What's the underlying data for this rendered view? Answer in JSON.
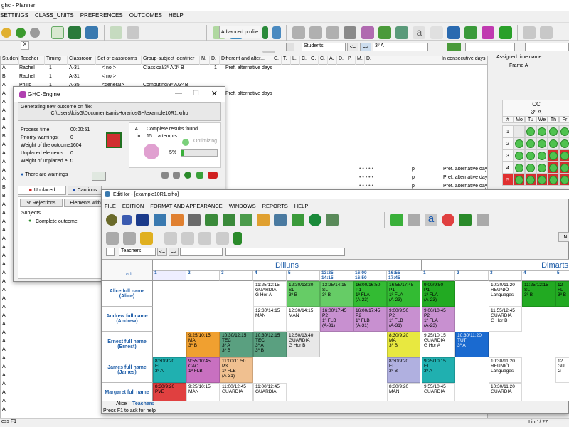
{
  "main": {
    "title": "ghc - Planner",
    "menu": [
      "SETTINGS",
      "CLASS_UNITS",
      "PREFERENCES",
      "OUTCOMES",
      "HELP"
    ],
    "toolbar": {
      "advanced_profile": "Advanced profile"
    },
    "filter": {
      "view": "Students",
      "nav_prev": "<=",
      "nav_next": "=>",
      "group": "3º A",
      "close": "X"
    },
    "columns": [
      "Students",
      "Teacher",
      "Timing",
      "Classroom",
      "Set of classrooms",
      "Group-subject identifier",
      "N.",
      "D.",
      "Different and alter...",
      "C.",
      "T.",
      "L.",
      "C.",
      "O.",
      "C.",
      "A.",
      "D.",
      "P.",
      "M.",
      "D.",
      "In consecutive days"
    ],
    "rows": [
      {
        "s": "A",
        "t": "Rachel",
        "tm": "1",
        "c": "A-31",
        "set": "< no >",
        "g": "Classical/3º A/3º B",
        "n": "1",
        "d": "Pref. alternative days"
      },
      {
        "s": "B",
        "t": "Rachel",
        "tm": "1",
        "c": "A-31",
        "set": "< no >",
        "g": "",
        "n": "",
        "d": ""
      },
      {
        "s": "A",
        "t": "Philip",
        "tm": "1",
        "c": "A-35",
        "set": "<general>",
        "g": "Computing/3º A/3º B",
        "n": "",
        "d": ""
      },
      {
        "s": "A",
        "t": "",
        "tm": "",
        "c": "",
        "set": "",
        "g": "",
        "n": "",
        "d": "Pref. alternative days"
      },
      {
        "s": "A",
        "t": "",
        "tm": "",
        "c": "",
        "set": "",
        "g": "",
        "n": "",
        "d": ""
      },
      {
        "s": "A",
        "t": "",
        "tm": "",
        "c": "",
        "set": "",
        "g": "",
        "n": "",
        "d": ""
      },
      {
        "s": "A",
        "t": "",
        "tm": "",
        "c": "",
        "set": "",
        "g": "",
        "n": "",
        "d": ""
      },
      {
        "s": "A",
        "t": "",
        "tm": "",
        "c": "",
        "set": "",
        "g": "",
        "n": "",
        "d": ""
      },
      {
        "s": "B",
        "t": "",
        "tm": "",
        "c": "",
        "set": "",
        "g": "",
        "n": "",
        "d": ""
      },
      {
        "s": "A",
        "t": "",
        "tm": "",
        "c": "",
        "set": "",
        "g": "",
        "n": "",
        "d": ""
      },
      {
        "s": "A",
        "t": "",
        "tm": "",
        "c": "",
        "set": "",
        "g": "",
        "n": "",
        "d": ""
      },
      {
        "s": "A",
        "t": "",
        "tm": "",
        "c": "",
        "set": "",
        "g": "",
        "n": "",
        "d": ""
      },
      {
        "s": "A",
        "t": "",
        "tm": "",
        "c": "",
        "set": "",
        "g": "",
        "n": "",
        "d": ""
      },
      {
        "s": "A",
        "t": "",
        "tm": "",
        "c": "",
        "set": "",
        "g": "",
        "n": "",
        "d": ""
      },
      {
        "s": "B",
        "t": "",
        "tm": "",
        "c": "",
        "set": "",
        "g": "",
        "n": "",
        "d": ""
      },
      {
        "s": "B",
        "t": "",
        "tm": "",
        "c": "",
        "set": "",
        "g": "",
        "n": "",
        "d": ""
      },
      {
        "s": "A",
        "t": "",
        "tm": "",
        "c": "",
        "set": "",
        "g": "",
        "n": "",
        "d": ""
      },
      {
        "s": "A",
        "t": "",
        "tm": "",
        "c": "",
        "set": "",
        "g": "",
        "n": "",
        "d": ""
      },
      {
        "s": "A",
        "t": "",
        "tm": "",
        "c": "",
        "set": "",
        "g": "",
        "n": "",
        "d": ""
      },
      {
        "s": "A",
        "t": "",
        "tm": "",
        "c": "",
        "set": "",
        "g": "",
        "n": "",
        "d": ""
      },
      {
        "s": "A",
        "t": "",
        "tm": "",
        "c": "",
        "set": "",
        "g": "",
        "n": "",
        "d": ""
      },
      {
        "s": "A",
        "t": "",
        "tm": "",
        "c": "",
        "set": "",
        "g": "",
        "n": "",
        "d": ""
      },
      {
        "s": "A",
        "t": "",
        "tm": "",
        "c": "",
        "set": "",
        "g": "",
        "n": "",
        "d": ""
      },
      {
        "s": "A",
        "t": "",
        "tm": "",
        "c": "",
        "set": "",
        "g": "",
        "n": "",
        "d": ""
      },
      {
        "s": "A",
        "t": "",
        "tm": "",
        "c": "",
        "set": "",
        "g": "",
        "n": "",
        "d": ""
      },
      {
        "s": "A",
        "t": "",
        "tm": "",
        "c": "",
        "set": "",
        "g": "",
        "n": "",
        "d": ""
      },
      {
        "s": "A",
        "t": "",
        "tm": "",
        "c": "",
        "set": "",
        "g": "",
        "n": "",
        "d": ""
      },
      {
        "s": "A",
        "t": "",
        "tm": "",
        "c": "",
        "set": "",
        "g": "",
        "n": "",
        "d": ""
      },
      {
        "s": "A",
        "t": "",
        "tm": "",
        "c": "",
        "set": "",
        "g": "",
        "n": "",
        "d": ""
      },
      {
        "s": "A",
        "t": "",
        "tm": "",
        "c": "",
        "set": "",
        "g": "",
        "n": "",
        "d": ""
      },
      {
        "s": "A",
        "t": "",
        "tm": "",
        "c": "",
        "set": "",
        "g": "",
        "n": "",
        "d": ""
      },
      {
        "s": "A",
        "t": "",
        "tm": "",
        "c": "",
        "set": "",
        "g": "",
        "n": "",
        "d": ""
      },
      {
        "s": "A",
        "t": "",
        "tm": "",
        "c": "",
        "set": "",
        "g": "",
        "n": "",
        "d": ""
      },
      {
        "s": "A",
        "t": "",
        "tm": "",
        "c": "",
        "set": "",
        "g": "",
        "n": "",
        "d": ""
      },
      {
        "s": "A",
        "t": "",
        "tm": "",
        "c": "",
        "set": "",
        "g": "",
        "n": "",
        "d": ""
      },
      {
        "s": "A",
        "t": "",
        "tm": "",
        "c": "",
        "set": "",
        "g": "",
        "n": "",
        "d": ""
      },
      {
        "s": "A",
        "t": "",
        "tm": "",
        "c": "",
        "set": "",
        "g": "",
        "n": "",
        "d": ""
      },
      {
        "s": "A",
        "t": "",
        "tm": "",
        "c": "",
        "set": "",
        "g": "",
        "n": "",
        "d": ""
      },
      {
        "s": "A",
        "t": "",
        "tm": "",
        "c": "",
        "set": "",
        "g": "",
        "n": "",
        "d": ""
      },
      {
        "s": "A",
        "t": "",
        "tm": "",
        "c": "",
        "set": "",
        "g": "",
        "n": "",
        "d": ""
      },
      {
        "s": "A",
        "t": "",
        "tm": "",
        "c": "",
        "set": "",
        "g": "",
        "n": "",
        "d": ""
      }
    ],
    "lower_p_rows": [
      {
        "p": "p",
        "d": "Pref. alternative days"
      },
      {
        "p": "p",
        "d": "Pref. alternative days"
      },
      {
        "p": "p",
        "d": "Pref. alternative days"
      },
      {
        "p": "p",
        "d": "Pref. alternative days"
      },
      {
        "p": "p",
        "d": "Pref. alternative days"
      }
    ],
    "statusbar": {
      "left": "ess F1",
      "right": "Lin 1/ 27"
    }
  },
  "right_panel": {
    "assigned_time_name": "Assigned time name",
    "frame": "Frame A",
    "class": "CC",
    "group": "3º A",
    "days_header": [
      "#",
      "Mo",
      "Tu",
      "We",
      "Th",
      "Fr"
    ],
    "rows": [
      "1",
      "2",
      "3",
      "4",
      "5"
    ]
  },
  "engine": {
    "title": "GHC-Engine",
    "generating_label": "Generating new outcome on file:",
    "file_path": "C:\\Users\\luisG\\Documents\\misHorariosGH\\example10R1.xrho",
    "process_time_label": "Process time:",
    "process_time": "00:00:51",
    "priority_warnings_label": "Priority warnings:",
    "priority_warnings": "0",
    "weight_label": "Weight of the outcome:",
    "weight": "1604",
    "unplaced_label": "Unplaced elements:",
    "unplaced": "0",
    "weight_unplaced_label": "Weight of unplaced el.:",
    "weight_unplaced": "0",
    "complete_results_count": "4",
    "complete_results_label": "Complete results found",
    "in_label": "in",
    "attempts_count": "15",
    "attempts_label": "attempts",
    "optimizing": "Optimizing",
    "percent": "5%",
    "progress": 0.05,
    "warnings": "There are warnings",
    "tabs": [
      "Unplaced",
      "Cautions"
    ],
    "sub_tabs": [
      "% Rejections",
      "Elements with"
    ],
    "tree_root": "Subjects",
    "tree_item": "Complete outcome"
  },
  "edithor": {
    "title": "EditHor - [example10R1.xrho]",
    "menu": [
      "FILE",
      "EDITION",
      "FORMAT AND APPEARANCE",
      "WINDOWS",
      "REPORTS",
      "HELP"
    ],
    "view": "Teachers",
    "nav_prev": "<=",
    "nav_next": "=>",
    "right_btn": "No",
    "day1": "Dilluns",
    "day2": "Dimarts",
    "corner": "/~1",
    "periods": [
      "1",
      "2",
      "3",
      "4",
      "5",
      "13:25\n14:15",
      "16:00\n16:50",
      "16:55\n17:45",
      "1",
      "2",
      "3",
      "4",
      "5"
    ],
    "teachers": [
      "Alice full name\n(Alice)",
      "Andrew full name\n(Andrew)",
      "Ernest full name\n(Ernest)",
      "James full name\n(James)",
      "Margaret full name"
    ],
    "tabs": [
      "Alice",
      "Teachers"
    ],
    "status": "Press F1 to ask for help"
  }
}
